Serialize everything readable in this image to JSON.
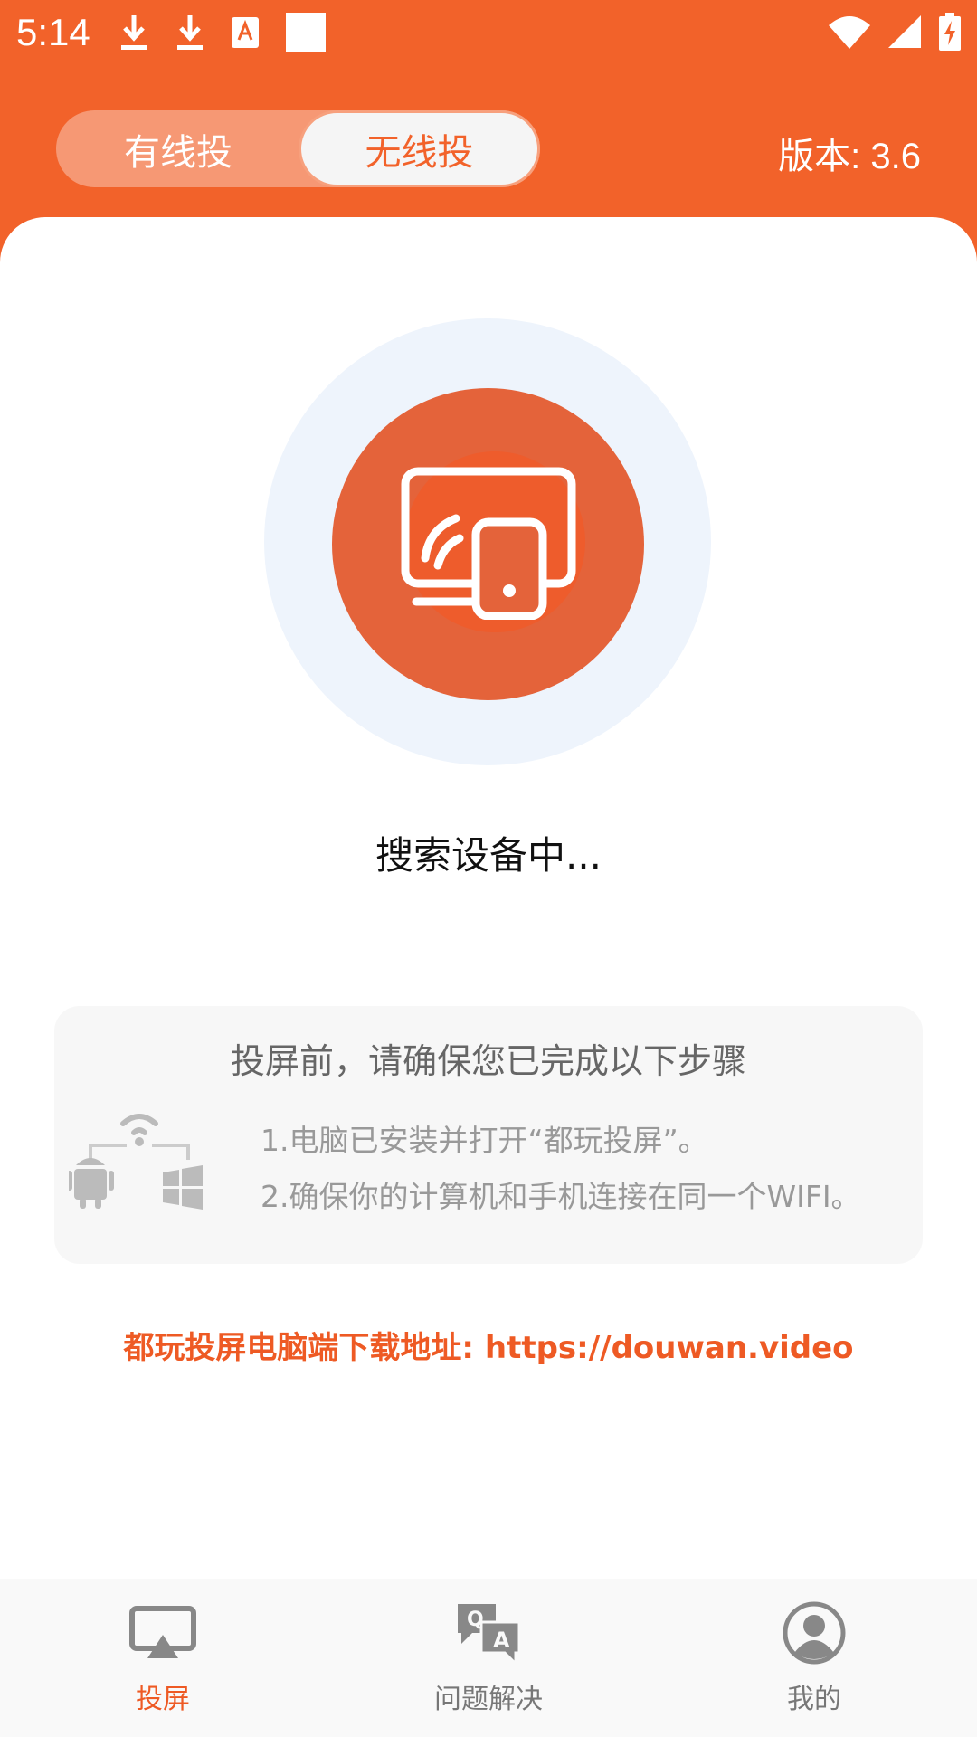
{
  "status_bar": {
    "time": "5:14",
    "icons_left": [
      "download-icon",
      "download-icon",
      "text-app-icon",
      "square-notification-icon"
    ],
    "icons_right": [
      "wifi-icon",
      "cell-signal-icon",
      "battery-charging-icon"
    ]
  },
  "header": {
    "tabs": [
      {
        "label": "有线投",
        "active": false
      },
      {
        "label": "无线投",
        "active": true
      }
    ],
    "version": "版本: 3.6"
  },
  "main": {
    "cast_icon": "screen-cast-icon",
    "status_text": "搜索设备中...",
    "steps": {
      "title": "投屏前，请确保您已完成以下步骤",
      "items": [
        "1.电脑已安装并打开“都玩投屏”。",
        "2.确保你的计算机和手机连接在同一个WIFI。"
      ]
    },
    "download_line": "都玩投屏电脑端下载地址: https://douwan.video"
  },
  "bottom_nav": [
    {
      "label": "投屏",
      "icon": "cast-screen-icon",
      "active": true
    },
    {
      "label": "问题解决",
      "icon": "qa-chat-icon",
      "active": false
    },
    {
      "label": "我的",
      "icon": "user-profile-icon",
      "active": false
    }
  ],
  "colors": {
    "brand_orange": "#f2622a",
    "circle_orange": "#e4633a",
    "halo_blue": "#eef4fc",
    "link_orange": "#ee5a24"
  }
}
